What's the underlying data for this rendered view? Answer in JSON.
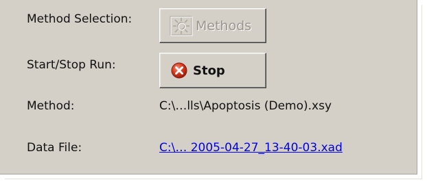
{
  "labels": {
    "method_selection": "Method Selection:",
    "start_stop_run": "Start/Stop Run:",
    "method": "Method:",
    "data_file": "Data File:"
  },
  "buttons": {
    "methods": {
      "label": "Methods",
      "icon": "methods-icon",
      "enabled": false
    },
    "stop": {
      "label": "Stop",
      "icon": "stop-icon",
      "enabled": true
    }
  },
  "values": {
    "method_path": "C:\\…lls\\Apoptosis (Demo).xsy",
    "data_file_link": "C:\\… 2005-04-27_13-40-03.xad"
  },
  "colors": {
    "panel_bg": "#d4d0c8",
    "link": "#0000ee",
    "stop_red": "#d83a1f"
  }
}
